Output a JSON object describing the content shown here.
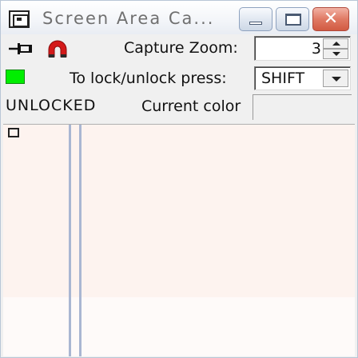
{
  "window": {
    "title": "Screen Area Ca...",
    "close_glyph": "✕"
  },
  "toolbar": {
    "pin_icon": "pin-icon",
    "magnet_icon": "magnet-icon"
  },
  "zoom": {
    "label": "Capture Zoom:",
    "value": "3"
  },
  "lock": {
    "label": "To lock/unlock press:",
    "key": "SHIFT",
    "indicator_color": "#00ee00"
  },
  "status": {
    "text": "UNLOCKED",
    "current_color_label": "Current color",
    "current_color": "#f0f0f0"
  },
  "canvas": {
    "background": "#fdf3ef"
  }
}
